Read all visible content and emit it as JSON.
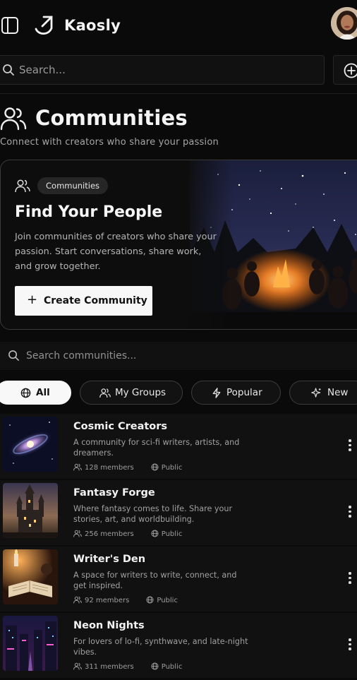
{
  "header": {
    "brand": "Kaosly",
    "icons": [
      "sidebar-toggle-icon",
      "logo-icon",
      "avatar"
    ]
  },
  "search": {
    "placeholder": "Search...",
    "add_icon": "plus-circle-icon"
  },
  "page": {
    "title": "Communities",
    "subtitle": "Connect with creators who share your passion",
    "title_icon": "users-icon"
  },
  "hero": {
    "badge": "Communities",
    "title": "Find Your People",
    "text": "Join communities of creators who share your passion. Start conversations, share work, and grow together.",
    "button_label": "Create Community",
    "image": "campfire-night-scene"
  },
  "community_search": {
    "placeholder": "Search communities..."
  },
  "filters": [
    {
      "label": "All",
      "icon": "globe-icon",
      "active": true
    },
    {
      "label": "My Groups",
      "icon": "users-icon",
      "active": false
    },
    {
      "label": "Popular",
      "icon": "lightning-icon",
      "active": false
    },
    {
      "label": "New",
      "icon": "sparkle-icon",
      "active": false
    }
  ],
  "communities": [
    {
      "name": "Cosmic Creators",
      "description": "A community for sci-fi writers, artists, and dreamers.",
      "members": "128 members",
      "visibility": "Public",
      "image": "galaxy"
    },
    {
      "name": "Fantasy Forge",
      "description": "Where fantasy comes to life. Share your stories, art, and worldbuilding.",
      "members": "256 members",
      "visibility": "Public",
      "image": "castle"
    },
    {
      "name": "Writer's Den",
      "description": "A space for writers to write, connect, and get inspired.",
      "members": "92 members",
      "visibility": "Public",
      "image": "book-candle"
    },
    {
      "name": "Neon Nights",
      "description": "For lovers of lo-fi, synthwave, and late-night vibes.",
      "members": "311 members",
      "visibility": "Public",
      "image": "neon-city"
    }
  ],
  "colors": {
    "background": "#0a0a0a",
    "surface": "#111111",
    "border": "#3a3a3a",
    "text": "#f2f2f2",
    "muted": "#a0a0a0"
  }
}
